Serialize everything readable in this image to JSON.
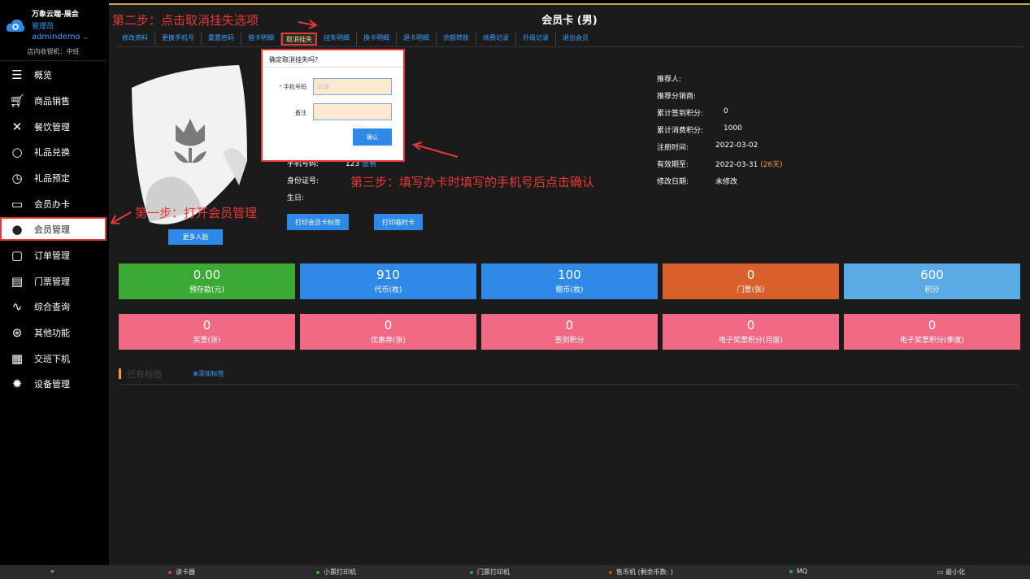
{
  "sidebar": {
    "brand_name": "万象云端-展会",
    "role": "管理员",
    "user": "admindemo",
    "shift": "店内收银机：中班",
    "items": [
      {
        "label": "概览",
        "icon": "menu-icon"
      },
      {
        "label": "商品销售",
        "icon": "cart-icon"
      },
      {
        "label": "餐饮管理",
        "icon": "utensils-icon"
      },
      {
        "label": "礼品兑换",
        "icon": "gift-icon"
      },
      {
        "label": "礼品预定",
        "icon": "clock-icon"
      },
      {
        "label": "会员办卡",
        "icon": "card-icon"
      },
      {
        "label": "会员管理",
        "icon": "user-icon"
      },
      {
        "label": "订单管理",
        "icon": "clipboard-icon"
      },
      {
        "label": "门票管理",
        "icon": "printer-icon"
      },
      {
        "label": "综合查询",
        "icon": "pulse-icon"
      },
      {
        "label": "其他功能",
        "icon": "settings-icon"
      },
      {
        "label": "交班下机",
        "icon": "calculator-icon"
      },
      {
        "label": "设备管理",
        "icon": "gear-icon"
      }
    ]
  },
  "main": {
    "title": "会员卡 (男)",
    "tabs": [
      "修改资料",
      "更换手机号",
      "重置密码",
      "借卡明细",
      "取消挂失",
      "挂失明细",
      "换卡明细",
      "退卡明细",
      "余额转账",
      "续费记录",
      "升级记录",
      "退出会员"
    ],
    "more_face": "更多人脸",
    "left_info": {
      "phone_label": "手机号码:",
      "phone_value": "123",
      "phone_link": "查看",
      "id_label": "身份证号:",
      "birthday_label": "生日:"
    },
    "print_buttons": [
      "打印会员卡标签",
      "打印临时卡"
    ],
    "right_info": [
      {
        "label": "推荐人:",
        "value": ""
      },
      {
        "label": "推荐分销商:",
        "value": ""
      },
      {
        "label": "累计签到积分:",
        "value": "0"
      },
      {
        "label": "累计消费积分:",
        "value": "1000"
      },
      {
        "label": "注册时间:",
        "value": "2022-03-02"
      },
      {
        "label": "有效期至:",
        "value": "2022-03-31",
        "extra": "(26天)"
      },
      {
        "label": "修改日期:",
        "value": "未修改"
      }
    ],
    "stats_row1": [
      {
        "value": "0.00",
        "caption": "预存款(元)",
        "color": "#3aaa35"
      },
      {
        "value": "910",
        "caption": "代币(枚)",
        "color": "#2e8ae6"
      },
      {
        "value": "100",
        "caption": "赠币(枚)",
        "color": "#2e8ae6"
      },
      {
        "value": "0",
        "caption": "门票(张)",
        "color": "#d9602b"
      },
      {
        "value": "600",
        "caption": "积分",
        "color": "#5aaae6"
      }
    ],
    "stats_row2": [
      {
        "value": "0",
        "caption": "奖票(张)",
        "color": "#f06a84"
      },
      {
        "value": "0",
        "caption": "优惠券(张)",
        "color": "#f06a84"
      },
      {
        "value": "0",
        "caption": "签到积分",
        "color": "#f06a84"
      },
      {
        "value": "0",
        "caption": "电子奖票积分(月度)",
        "color": "#f06a84"
      },
      {
        "value": "0",
        "caption": "电子奖票积分(季度)",
        "color": "#f06a84"
      }
    ],
    "tags_title": "已有标签",
    "add_tag": "添加标签"
  },
  "dialog": {
    "title": "确定取消挂失吗?",
    "phone_label": "手机号码",
    "phone_placeholder": "必填",
    "note_label": "备注",
    "ok": "确认"
  },
  "annotations": {
    "step1": "第一步：打开会员管理",
    "step2": "第二步：点击取消挂失选项",
    "step3": "第三步：填写办卡时填写的手机号后点击确认"
  },
  "statusbar": {
    "collapse": "«",
    "items": [
      {
        "label": "读卡器",
        "color": "#e53935"
      },
      {
        "label": "小票打印机",
        "color": "#3aaa35"
      },
      {
        "label": "门票打印机",
        "color": "#3aaa35"
      },
      {
        "label": "售币机 (剩余币数: )",
        "color": "#e53935"
      },
      {
        "label": "MQ",
        "color": "#3aaa35"
      }
    ],
    "minimize": "最小化"
  }
}
